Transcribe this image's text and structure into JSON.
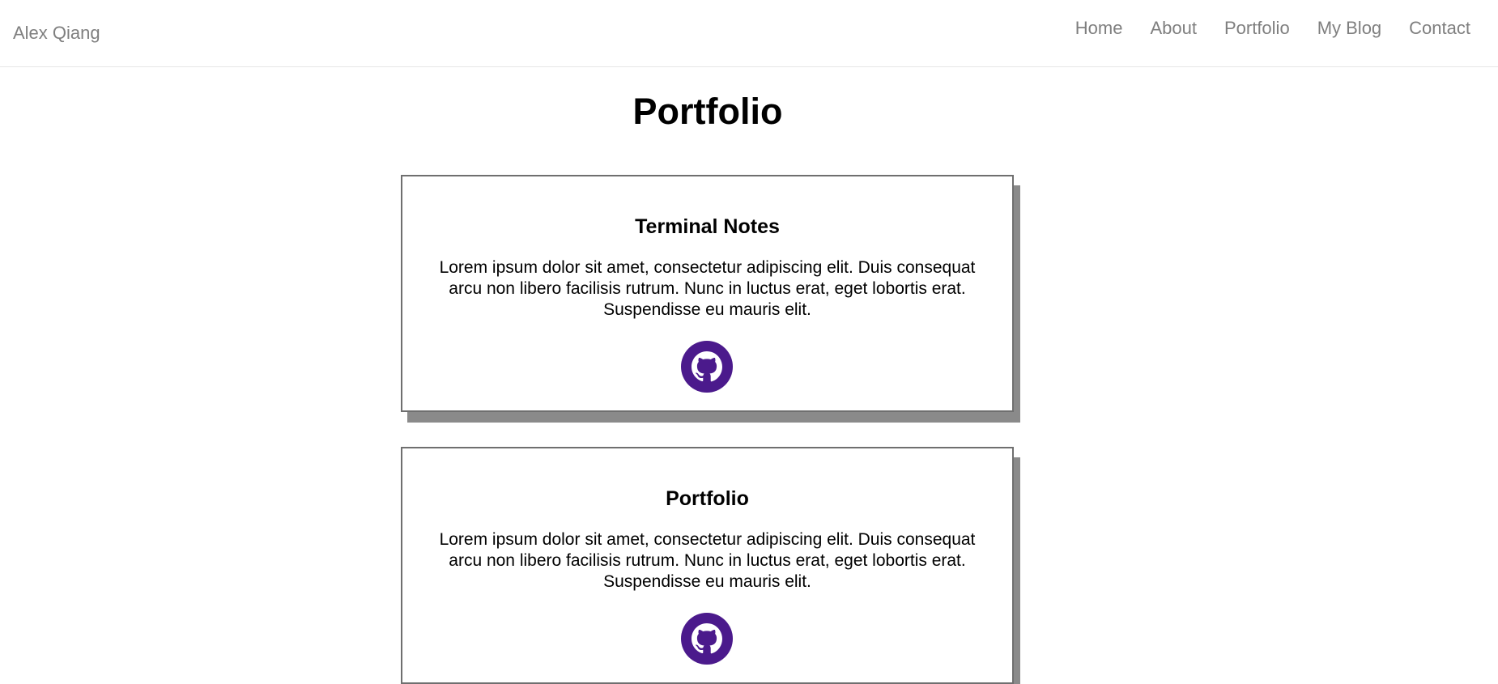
{
  "navbar": {
    "brand": "Alex Qiang",
    "links": [
      "Home",
      "About",
      "Portfolio",
      "My Blog",
      "Contact"
    ]
  },
  "main": {
    "title": "Portfolio",
    "projects": [
      {
        "title": "Terminal Notes",
        "description": "Lorem ipsum dolor sit amet, consectetur adipiscing elit. Duis consequat arcu non libero facilisis rutrum. Nunc in luctus erat, eget lobortis erat. Suspendisse eu mauris elit.",
        "icon": "github-icon"
      },
      {
        "title": "Portfolio",
        "description": "Lorem ipsum dolor sit amet, consectetur adipiscing elit. Duis consequat arcu non libero facilisis rutrum. Nunc in luctus erat, eget lobortis erat. Suspendisse eu mauris elit.",
        "icon": "github-icon"
      }
    ]
  },
  "colors": {
    "nav_text": "#7f7f7f",
    "github_icon": "#4b1a8c",
    "card_shadow": "#8a8a8a",
    "card_border": "#6f6f6f"
  }
}
